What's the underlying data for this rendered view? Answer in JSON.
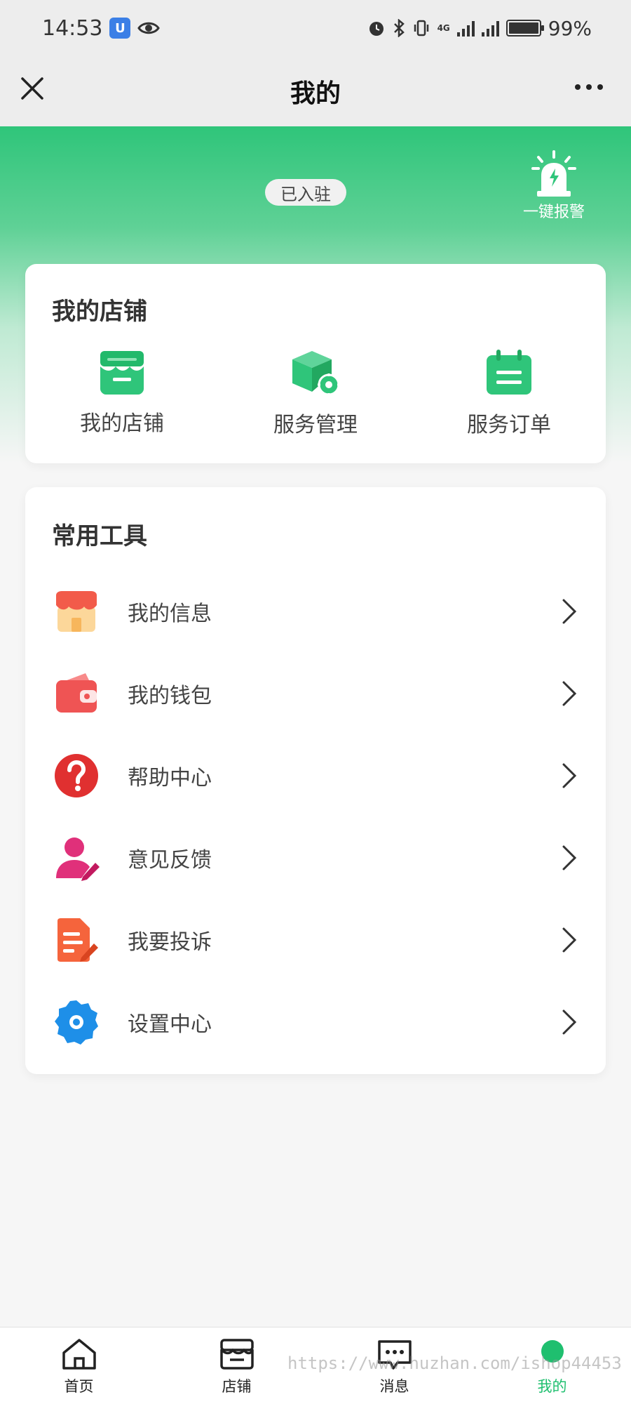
{
  "status_bar": {
    "time": "14:53",
    "network_label": "4G",
    "battery_percent": "99%"
  },
  "nav": {
    "title": "我的",
    "close_icon": "close-icon",
    "more_icon": "more-icon"
  },
  "hero": {
    "joined_badge": "已入驻",
    "alarm_label": "一键报警"
  },
  "store_card": {
    "title": "我的店铺",
    "items": [
      {
        "label": "我的店铺",
        "icon": "store-icon"
      },
      {
        "label": "服务管理",
        "icon": "service-box-icon"
      },
      {
        "label": "服务订单",
        "icon": "calendar-order-icon"
      }
    ]
  },
  "tools_card": {
    "title": "常用工具",
    "items": [
      {
        "label": "我的信息",
        "icon": "shop-info-icon"
      },
      {
        "label": "我的钱包",
        "icon": "wallet-icon"
      },
      {
        "label": "帮助中心",
        "icon": "help-icon"
      },
      {
        "label": "意见反馈",
        "icon": "feedback-icon"
      },
      {
        "label": "我要投诉",
        "icon": "complaint-icon"
      },
      {
        "label": "设置中心",
        "icon": "settings-icon"
      }
    ]
  },
  "tab_bar": {
    "tabs": [
      {
        "label": "首页",
        "icon": "home-icon",
        "active": false
      },
      {
        "label": "店铺",
        "icon": "shop-icon",
        "active": false
      },
      {
        "label": "消息",
        "icon": "message-icon",
        "active": false
      },
      {
        "label": "我的",
        "icon": "profile-icon",
        "active": true
      }
    ]
  },
  "colors": {
    "brand_green": "#2fc57a",
    "active_tab": "#1fbf6f"
  },
  "watermark": "https://www.huzhan.com/ishop44453"
}
